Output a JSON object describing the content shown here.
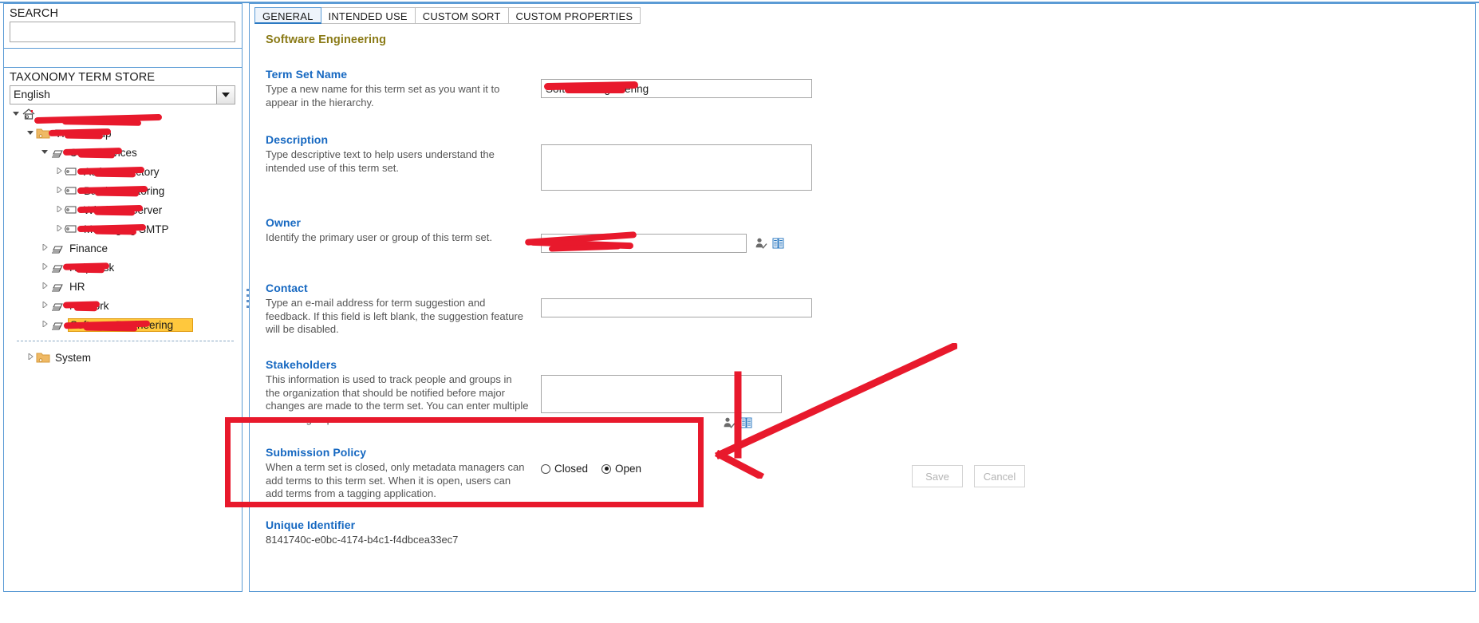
{
  "left": {
    "search_label": "SEARCH",
    "search_value": "",
    "search_placeholder": "",
    "store_label": "TAXONOMY TERM STORE",
    "language": "English",
    "tree": [
      {
        "label": "",
        "icon": "home-icon",
        "indent": 0,
        "twisty": "open",
        "redacted": true,
        "redact_w": 160,
        "selected": false
      },
      {
        "label": "TRM Group",
        "icon": "group-folder-icon",
        "indent": 1,
        "twisty": "open",
        "redacted": true,
        "redact_w": 78,
        "selected": false
      },
      {
        "label": "Core Services",
        "icon": "termset-icon",
        "indent": 2,
        "twisty": "open",
        "redacted": true,
        "redact_w": 74,
        "selected": false
      },
      {
        "label": "Active Directory",
        "icon": "term-icon",
        "indent": 3,
        "twisty": "closed",
        "redacted": true,
        "redact_w": 84,
        "selected": false
      },
      {
        "label": "Batch Monitoring",
        "icon": "term-icon",
        "indent": 3,
        "twisty": "closed",
        "redacted": true,
        "redact_w": 88,
        "selected": false
      },
      {
        "label": "Windows Server",
        "icon": "term-icon",
        "indent": 3,
        "twisty": "closed",
        "redacted": true,
        "redact_w": 82,
        "selected": false
      },
      {
        "label": "Messaging SMTP",
        "icon": "term-icon",
        "indent": 3,
        "twisty": "closed",
        "redacted": true,
        "redact_w": 86,
        "selected": false
      },
      {
        "label": "Finance",
        "icon": "termset-icon",
        "indent": 2,
        "twisty": "closed",
        "redacted": false,
        "redact_w": 0,
        "selected": false
      },
      {
        "label": "Helpdesk",
        "icon": "termset-icon",
        "indent": 2,
        "twisty": "closed",
        "redacted": true,
        "redact_w": 58,
        "selected": false
      },
      {
        "label": "HR",
        "icon": "termset-icon",
        "indent": 2,
        "twisty": "closed",
        "redacted": false,
        "redact_w": 0,
        "selected": false
      },
      {
        "label": "Network",
        "icon": "termset-icon",
        "indent": 2,
        "twisty": "closed",
        "redacted": true,
        "redact_w": 46,
        "selected": false
      },
      {
        "label": "Software Engineering",
        "icon": "termset-icon",
        "indent": 2,
        "twisty": "closed",
        "redacted": true,
        "redact_w": 108,
        "selected": true
      },
      {
        "label": "System",
        "icon": "group-folder-icon",
        "indent": 1,
        "twisty": "closed",
        "redacted": false,
        "redact_w": 0,
        "selected": false
      }
    ]
  },
  "right": {
    "tabs": [
      {
        "label": "GENERAL",
        "active": true
      },
      {
        "label": "INTENDED USE",
        "active": false
      },
      {
        "label": "CUSTOM SORT",
        "active": false
      },
      {
        "label": "CUSTOM PROPERTIES",
        "active": false
      }
    ],
    "page_title": "Software Engineering",
    "fields": {
      "term_set_name": {
        "heading": "Term Set Name",
        "description": "Type a new name for this term set as you want it to appear in the hierarchy.",
        "value": "Software Engineering"
      },
      "description": {
        "heading": "Description",
        "description": "Type descriptive text to help users understand the intended use of this term set.",
        "value": ""
      },
      "owner": {
        "heading": "Owner",
        "description": "Identify the primary user or group of this term set.",
        "value": "",
        "check_names_icon": "check-names-icon",
        "browse_icon": "address-book-icon"
      },
      "contact": {
        "heading": "Contact",
        "description": "Type an e-mail address for term suggestion and feedback. If this field is left blank, the suggestion feature will be disabled.",
        "value": ""
      },
      "stakeholders": {
        "heading": "Stakeholders",
        "description": "This information is used to track people and groups in the organization that should be notified before major changes are made to the term set. You can enter multiple users or groups.",
        "value": "",
        "check_names_icon": "check-names-icon",
        "browse_icon": "address-book-icon"
      },
      "submission_policy": {
        "heading": "Submission Policy",
        "description": "When a term set is closed, only metadata managers can add terms to this term set. When it is open, users can add terms from a tagging application.",
        "option_closed": "Closed",
        "option_open": "Open",
        "selected": "Open"
      },
      "unique_identifier": {
        "heading": "Unique Identifier",
        "value": "8141740c-e0bc-4174-b4c1-f4dbcea33ec7"
      }
    },
    "buttons": {
      "save": "Save",
      "cancel": "Cancel"
    }
  },
  "annotations": {
    "highlight_color": "#e8192c",
    "selection_color": "#ffc83d",
    "accent_color": "#1668c1",
    "panel_border_color": "#5b9bd5",
    "title_color": "#8a7a16"
  }
}
